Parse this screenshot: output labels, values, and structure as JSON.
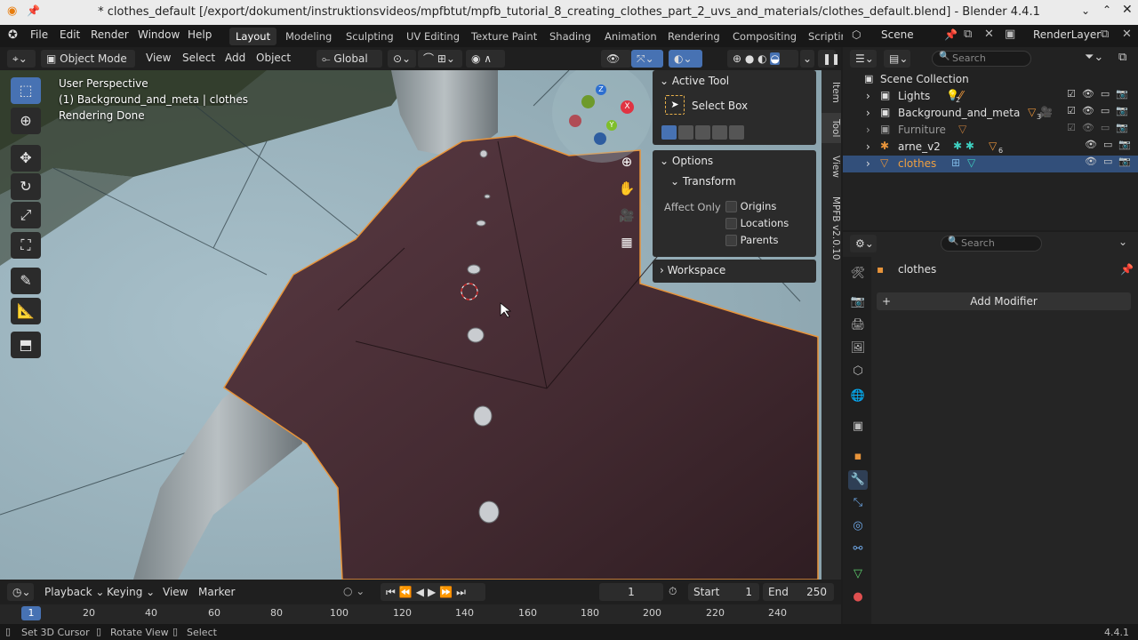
{
  "window": {
    "title": "* clothes_default [/export/dokument/instruktionsvideos/mpfbtut/mpfb_tutorial_8_creating_clothes_part_2_uvs_and_materials/clothes_default.blend] - Blender 4.4.1"
  },
  "menu": [
    "File",
    "Edit",
    "Render",
    "Window",
    "Help"
  ],
  "workspaces": [
    "Layout",
    "Modeling",
    "Sculpting",
    "UV Editing",
    "Texture Paint",
    "Shading",
    "Animation",
    "Rendering",
    "Compositing",
    "Scriptin"
  ],
  "scene": {
    "name": "Scene",
    "render_layer": "RenderLayer"
  },
  "viewport_header": {
    "mode": "Object Mode",
    "view": "View",
    "select": "Select",
    "add": "Add",
    "object": "Object",
    "orientation": "Global"
  },
  "overlay": {
    "line1": "User Perspective",
    "line2": "(1) Background_and_meta | clothes",
    "line3": "Rendering Done"
  },
  "gizmo": {
    "x": "X",
    "y": "Y",
    "z": "Z"
  },
  "npanel": {
    "active_tool": "Active Tool",
    "select_box": "Select Box",
    "options": "Options",
    "transform": "Transform",
    "affect_only": "Affect Only",
    "origins": "Origins",
    "locations": "Locations",
    "parents": "Parents",
    "workspace": "Workspace",
    "tabs": [
      "Item",
      "Tool",
      "View",
      "MPFB v2.0.10"
    ]
  },
  "outliner": {
    "search_placeholder": "Search",
    "collection": "Scene Collection",
    "items": [
      {
        "name": "Lights",
        "badge": "2"
      },
      {
        "name": "Background_and_meta",
        "badge": "3"
      },
      {
        "name": "Furniture",
        "badge": ""
      },
      {
        "name": "arne_v2",
        "badge": "6"
      },
      {
        "name": "clothes",
        "badge": ""
      }
    ]
  },
  "properties": {
    "search_placeholder": "Search",
    "object_name": "clothes",
    "add_modifier": "Add Modifier"
  },
  "timeline": {
    "playback": "Playback",
    "keying": "Keying",
    "view": "View",
    "marker": "Marker",
    "current_frame": "1",
    "start_label": "Start",
    "start": "1",
    "end_label": "End",
    "end": "250",
    "ruler": [
      "1",
      "20",
      "40",
      "60",
      "80",
      "100",
      "120",
      "140",
      "160",
      "180",
      "200",
      "220",
      "240"
    ]
  },
  "status": {
    "cursor": "Set 3D Cursor",
    "rotate": "Rotate View",
    "select": "Select",
    "version": "4.4.1"
  },
  "colors": {
    "accent": "#4772b3",
    "shirt": "#4a2d34",
    "sky": "#9ab3bd",
    "selected_outline": "#e8943a"
  }
}
